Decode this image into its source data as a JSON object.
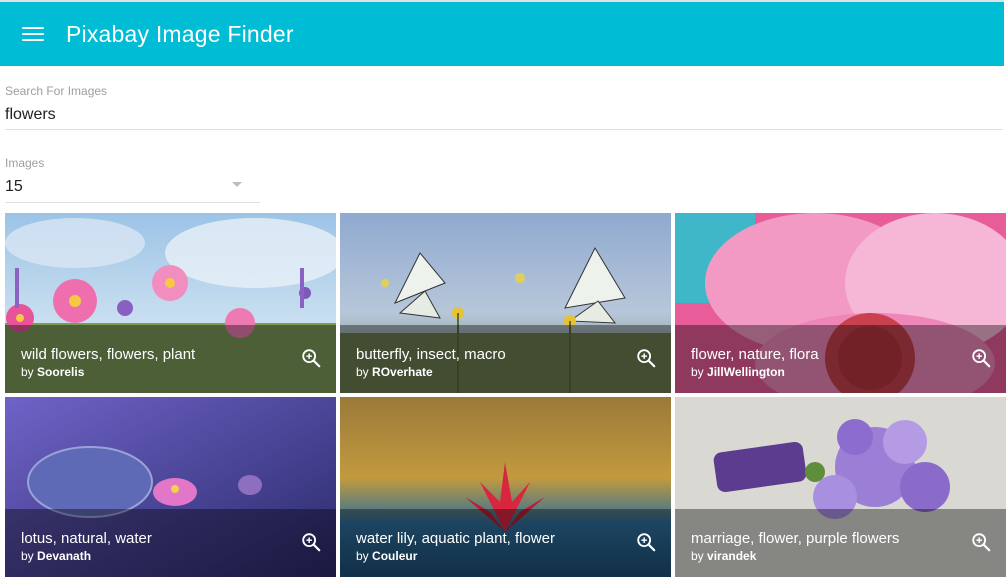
{
  "appbar": {
    "title": "Pixabay Image Finder",
    "menu_icon": "menu-icon"
  },
  "search": {
    "label": "Search For Images",
    "value": "flowers"
  },
  "images": {
    "label": "Images",
    "value": "15"
  },
  "tiles": [
    {
      "title": "wild flowers, flowers, plant",
      "by": "by",
      "author": "Soorelis"
    },
    {
      "title": "butterfly, insect, macro",
      "by": "by",
      "author": "ROverhate"
    },
    {
      "title": "flower, nature, flora",
      "by": "by",
      "author": "JillWellington"
    },
    {
      "title": "lotus, natural, water",
      "by": "by",
      "author": "Devanath"
    },
    {
      "title": "water lily, aquatic plant, flower",
      "by": "by",
      "author": "Couleur"
    },
    {
      "title": "marriage, flower, purple flowers",
      "by": "by",
      "author": "virandek"
    }
  ],
  "colors": {
    "appbar": "#00bcd4",
    "caption_overlay": "rgba(0,0,0,0.38)"
  }
}
